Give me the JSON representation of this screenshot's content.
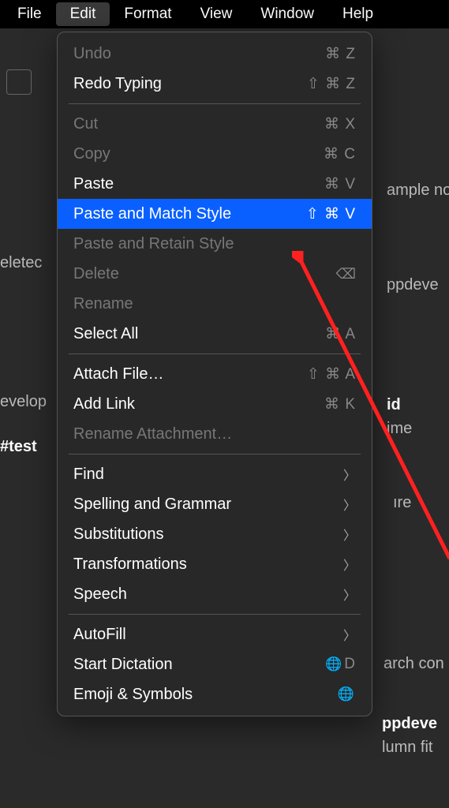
{
  "menubar": {
    "file": "File",
    "edit": "Edit",
    "format": "Format",
    "view": "View",
    "window": "Window",
    "help": "Help"
  },
  "menu": {
    "undo": {
      "label": "Undo",
      "shortcut": "⌘ Z"
    },
    "redo": {
      "label": "Redo Typing",
      "shortcut": "⇧ ⌘ Z"
    },
    "cut": {
      "label": "Cut",
      "shortcut": "⌘ X"
    },
    "copy": {
      "label": "Copy",
      "shortcut": "⌘ C"
    },
    "paste": {
      "label": "Paste",
      "shortcut": "⌘ V"
    },
    "paste_match": {
      "label": "Paste and Match Style",
      "shortcut": "⇧ ⌘ V"
    },
    "paste_retain": {
      "label": "Paste and Retain Style",
      "shortcut": ""
    },
    "delete": {
      "label": "Delete",
      "shortcut": ""
    },
    "rename": {
      "label": "Rename",
      "shortcut": ""
    },
    "select_all": {
      "label": "Select All",
      "shortcut": "⌘ A"
    },
    "attach_file": {
      "label": "Attach File…",
      "shortcut": "⇧ ⌘ A"
    },
    "add_link": {
      "label": "Add Link",
      "shortcut": "⌘ K"
    },
    "rename_attachment": {
      "label": "Rename Attachment…",
      "shortcut": ""
    },
    "find": {
      "label": "Find",
      "shortcut": ""
    },
    "spelling": {
      "label": "Spelling and Grammar",
      "shortcut": ""
    },
    "substitutions": {
      "label": "Substitutions",
      "shortcut": ""
    },
    "transformations": {
      "label": "Transformations",
      "shortcut": ""
    },
    "speech": {
      "label": "Speech",
      "shortcut": ""
    },
    "autofill": {
      "label": "AutoFill",
      "shortcut": ""
    },
    "start_dictation": {
      "label": "Start Dictation",
      "shortcut": "D"
    },
    "emoji": {
      "label": "Emoji & Symbols",
      "shortcut": ""
    }
  },
  "bg": {
    "t1": "ample no",
    "t2": "eletec",
    "t3": "ppdeve",
    "t4": "evelop",
    "t5": "#test",
    "t6": "id",
    "t7": "ime",
    "t8": "ıre",
    "t9": "arch con",
    "t10": "ppdeve",
    "t11": "lumn fit"
  }
}
